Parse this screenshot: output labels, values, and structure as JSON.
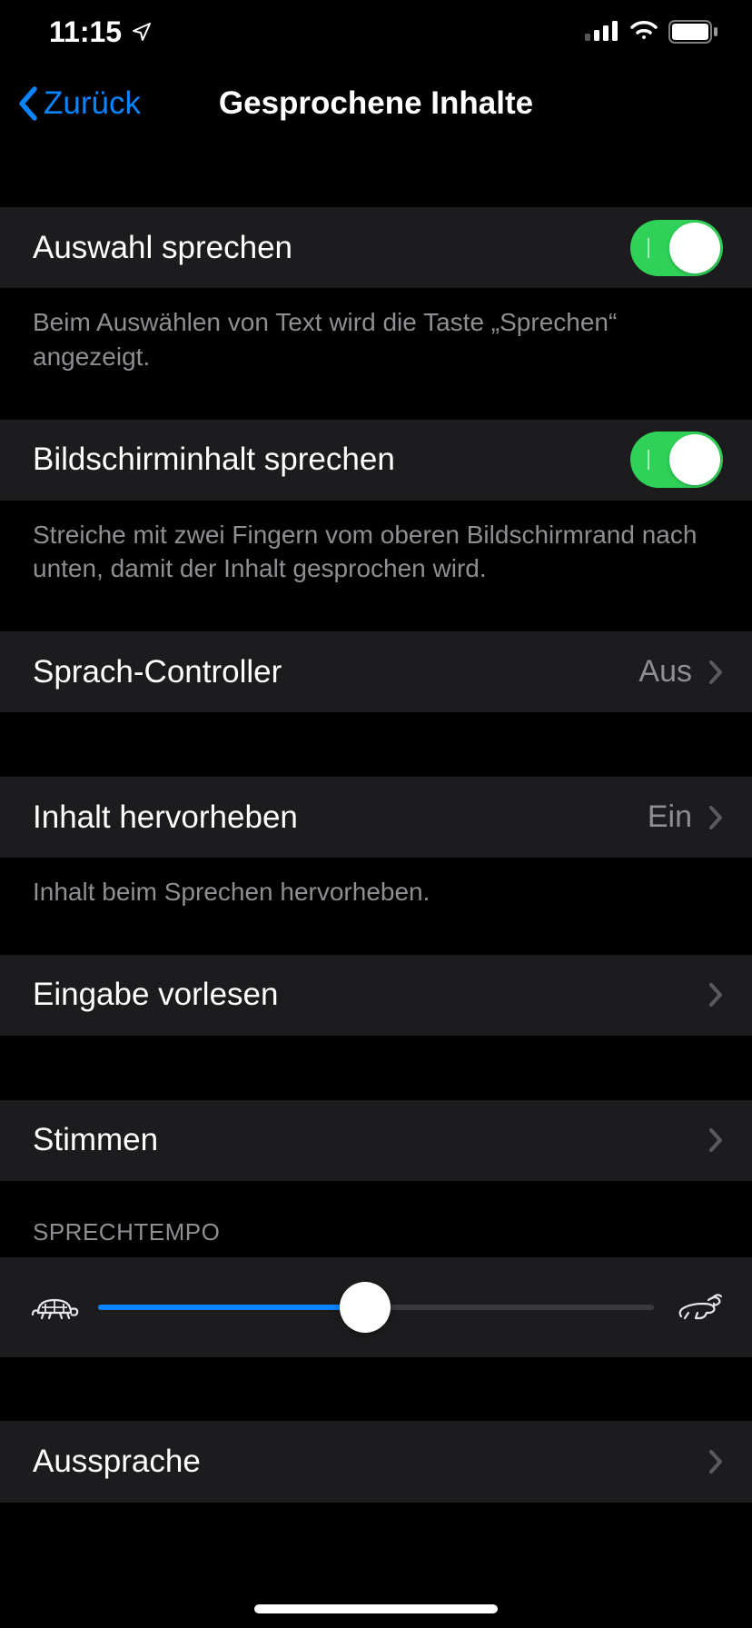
{
  "statusBar": {
    "time": "11:15"
  },
  "nav": {
    "back": "Zurück",
    "title": "Gesprochene Inhalte"
  },
  "rows": {
    "speakSelection": {
      "label": "Auswahl sprechen",
      "footer": "Beim Auswählen von Text wird die Taste „Sprechen“ angezeigt.",
      "enabled": true
    },
    "speakScreen": {
      "label": "Bildschirminhalt sprechen",
      "footer": "Streiche mit zwei Fingern vom oberen Bildschirmrand nach unten, damit der Inhalt gesprochen wird.",
      "enabled": true
    },
    "speechController": {
      "label": "Sprach-Controller",
      "value": "Aus"
    },
    "highlightContent": {
      "label": "Inhalt hervorheben",
      "value": "Ein",
      "footer": "Inhalt beim Sprechen hervorheben."
    },
    "typingFeedback": {
      "label": "Eingabe vorlesen"
    },
    "voices": {
      "label": "Stimmen"
    },
    "speakingRate": {
      "header": "SPRECHTEMPO",
      "percent": 48
    },
    "pronunciations": {
      "label": "Aussprache"
    }
  }
}
